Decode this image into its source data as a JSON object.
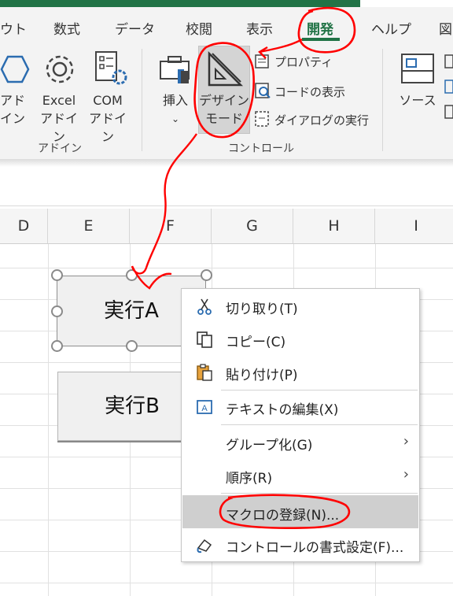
{
  "ribbon": {
    "tabs": [
      {
        "label": "ウト"
      },
      {
        "label": "数式"
      },
      {
        "label": "データ"
      },
      {
        "label": "校閲"
      },
      {
        "label": "表示"
      },
      {
        "label": "開発"
      },
      {
        "label": "ヘルプ"
      },
      {
        "label": "図"
      }
    ],
    "addins": {
      "addin_label": "アド\nイン",
      "excel_addin_label": "Excel\nアドイン",
      "com_addin_label": "COM\nアドイン",
      "group_label": "アドイン"
    },
    "controls": {
      "insert_label": "挿入",
      "design_mode_label": "デザイン\nモード",
      "properties_label": "プロパティ",
      "view_code_label": "コードの表示",
      "run_dialog_label": "ダイアログの実行",
      "group_label": "コントロール"
    },
    "xml": {
      "source_label": "ソース"
    }
  },
  "columns": [
    "D",
    "E",
    "F",
    "G",
    "H",
    "I"
  ],
  "sheet": {
    "button_a": "実行A",
    "button_b": "実行B"
  },
  "context_menu": {
    "items": [
      {
        "label": "切り取り(T)",
        "icon": "scissors-icon"
      },
      {
        "label": "コピー(C)",
        "icon": "copy-icon"
      },
      {
        "label": "貼り付け(P)",
        "icon": "paste-icon"
      },
      {
        "label": "テキストの編集(X)",
        "icon": "edit-text-icon"
      },
      {
        "label": "グループ化(G)",
        "submenu": true
      },
      {
        "label": "順序(R)",
        "submenu": true
      },
      {
        "label": "マクロの登録(N)...",
        "highlighted": true
      },
      {
        "label": "コントロールの書式設定(F)...",
        "icon": "format-control-icon"
      }
    ]
  },
  "colors": {
    "excel_green": "#217346",
    "annotation_red": "#ff0000",
    "menu_highlight": "#cfcfcf"
  }
}
